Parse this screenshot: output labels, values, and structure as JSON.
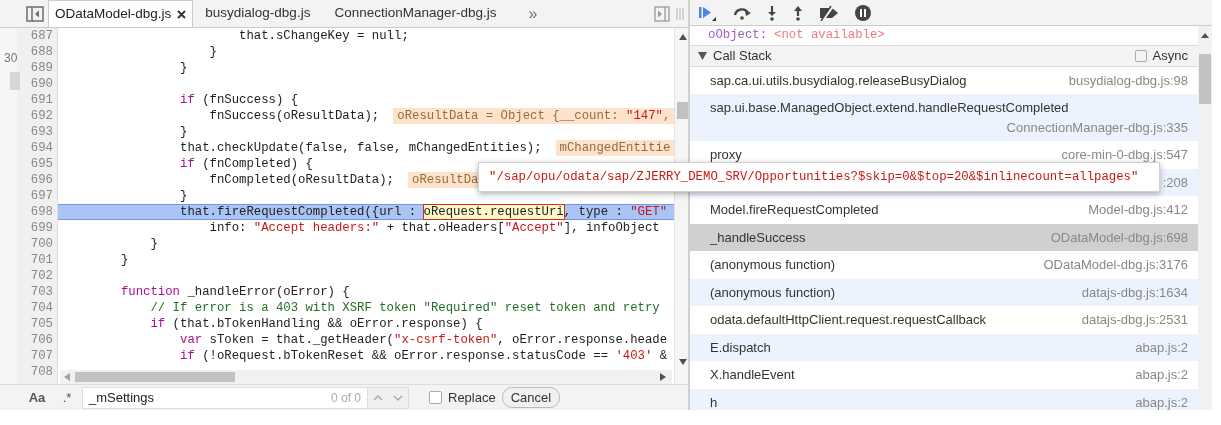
{
  "edge_gutter": {
    "text": "30"
  },
  "tabs": [
    {
      "label": "ODataModel-dbg.js",
      "selected": true,
      "closable": true
    },
    {
      "label": "busydialog-dbg.js",
      "selected": false,
      "closable": false
    },
    {
      "label": "ConnectionManager-dbg.js",
      "selected": false,
      "closable": false
    }
  ],
  "tabs_overflow": "»",
  "code": {
    "lines": [
      {
        "number": "687",
        "current": false,
        "tokens": [
          {
            "kind": "plain",
            "text": "                        that.sChangeKey = null;"
          }
        ]
      },
      {
        "number": "688",
        "current": false,
        "tokens": [
          {
            "kind": "plain",
            "text": "                    }"
          }
        ]
      },
      {
        "number": "689",
        "current": false,
        "tokens": [
          {
            "kind": "plain",
            "text": "                }"
          }
        ]
      },
      {
        "number": "690",
        "current": false
      },
      {
        "number": "691",
        "current": false,
        "tokens": [
          {
            "kind": "keyword",
            "text": "                if"
          },
          {
            "kind": "plain",
            "text": " (fnSuccess) {"
          }
        ]
      },
      {
        "number": "692",
        "current": false,
        "tokens": [
          {
            "kind": "plain",
            "text": "                    fnSuccess(oResultData);"
          }
        ],
        "hint": [
          {
            "kind": "plain",
            "text": "oResultData = Object {__count: "
          },
          {
            "kind": "string",
            "text": "\"147\""
          },
          {
            "kind": "plain",
            "text": ","
          }
        ]
      },
      {
        "number": "693",
        "current": false,
        "tokens": [
          {
            "kind": "plain",
            "text": "                }"
          }
        ]
      },
      {
        "number": "694",
        "current": false,
        "tokens": [
          {
            "kind": "plain",
            "text": "                that.checkUpdate(false, false, mChangedEntities);"
          }
        ],
        "hint": [
          {
            "kind": "plain",
            "text": "mChangedEntitie"
          }
        ]
      },
      {
        "number": "695",
        "current": false,
        "tokens": [
          {
            "kind": "keyword",
            "text": "                if"
          },
          {
            "kind": "plain",
            "text": " (fnCompleted) {"
          }
        ]
      },
      {
        "number": "696",
        "current": false,
        "tokens": [
          {
            "kind": "plain",
            "text": "                    fnCompleted(oResultData);"
          }
        ],
        "hint": [
          {
            "kind": "plain",
            "text": "oResultDa"
          }
        ]
      },
      {
        "number": "697",
        "current": false,
        "tokens": [
          {
            "kind": "plain",
            "text": "                }"
          }
        ]
      },
      {
        "number": "698",
        "current": true,
        "tokens": [
          {
            "kind": "plain",
            "text": "                that.fireRequestCompleted({url : "
          },
          {
            "kind": "hovered",
            "text": "oRequest.requestUri"
          },
          {
            "kind": "plain",
            "text": ", type : "
          },
          {
            "kind": "string",
            "text": "\"GET\""
          }
        ]
      },
      {
        "number": "699",
        "current": false,
        "tokens": [
          {
            "kind": "plain",
            "text": "                    info: "
          },
          {
            "kind": "string",
            "text": "\"Accept headers:\""
          },
          {
            "kind": "plain",
            "text": " + that.oHeaders["
          },
          {
            "kind": "string",
            "text": "\"Accept\""
          },
          {
            "kind": "plain",
            "text": "], infoObject"
          }
        ]
      },
      {
        "number": "700",
        "current": false,
        "tokens": [
          {
            "kind": "plain",
            "text": "            }"
          }
        ]
      },
      {
        "number": "701",
        "current": false,
        "tokens": [
          {
            "kind": "plain",
            "text": "        }"
          }
        ]
      },
      {
        "number": "702",
        "current": false
      },
      {
        "number": "703",
        "current": false,
        "tokens": [
          {
            "kind": "keyword",
            "text": "        function"
          },
          {
            "kind": "plain",
            "text": " _handleError(oError) {"
          }
        ]
      },
      {
        "number": "704",
        "current": false,
        "tokens": [
          {
            "kind": "comment",
            "text": "            // If error is a 403 with XSRF token \"Required\" reset token and retry"
          }
        ]
      },
      {
        "number": "705",
        "current": false,
        "tokens": [
          {
            "kind": "keyword",
            "text": "            if"
          },
          {
            "kind": "plain",
            "text": " (that.bTokenHandling && oError.response) {"
          }
        ]
      },
      {
        "number": "706",
        "current": false,
        "tokens": [
          {
            "kind": "keyword",
            "text": "                var"
          },
          {
            "kind": "plain",
            "text": " sToken = that._getHeader("
          },
          {
            "kind": "string",
            "text": "\"x-csrf-token\""
          },
          {
            "kind": "plain",
            "text": ", oError.response.heade"
          }
        ]
      },
      {
        "number": "707",
        "current": false,
        "tokens": [
          {
            "kind": "keyword",
            "text": "                if"
          },
          {
            "kind": "plain",
            "text": " (!oRequest.bTokenReset && oError.response.statusCode == "
          },
          {
            "kind": "string",
            "text": "'403'"
          },
          {
            "kind": "plain",
            "text": " &"
          }
        ]
      },
      {
        "number": "708",
        "current": false
      }
    ]
  },
  "tooltip": {
    "text": "\"/sap/opu/odata/sap/ZJERRY_DEMO_SRV/Opportunities?$skip=0&$top=20&$inlinecount=allpages\""
  },
  "search_bar": {
    "match_case": "Aa",
    "regex": ".*",
    "query": "_mSettings",
    "count": "0 of 0",
    "replace": {
      "label": "Replace",
      "checked": false
    },
    "cancel": "Cancel"
  },
  "scope_variable": {
    "name": "oObject:",
    "value": "<not available>"
  },
  "call_stack": {
    "title": "Call Stack",
    "expanded": true,
    "async": {
      "label": "Async",
      "checked": false
    },
    "frames": [
      {
        "function": "sap.ca.ui.utils.busydialog.releaseBusyDialog",
        "location": "busydialog-dbg.js:98",
        "selected": false
      },
      {
        "function": "sap.ui.base.ManagedObject.extend.handleRequestCompleted",
        "location": "ConnectionManager-dbg.js:335",
        "selected": false
      },
      {
        "function": "proxy",
        "location": "core-min-0-dbg.js:547",
        "selected": false
      },
      {
        "location": ":208",
        "selected": false
      },
      {
        "function": "Model.fireRequestCompleted",
        "location": "Model-dbg.js:412",
        "selected": false
      },
      {
        "function": "_handleSuccess",
        "location": "ODataModel-dbg.js:698",
        "selected": true
      },
      {
        "function": "(anonymous function)",
        "location": "ODataModel-dbg.js:3176",
        "selected": false
      },
      {
        "function": "(anonymous function)",
        "location": "datajs-dbg.js:1634",
        "selected": false
      },
      {
        "function": "odata.defaultHttpClient.request.requestCallback",
        "location": "datajs-dbg.js:2531",
        "selected": false
      },
      {
        "function": "E.dispatch",
        "location": "abap.js:2",
        "selected": false
      },
      {
        "function": "X.handleEvent",
        "location": "abap.js:2",
        "selected": false
      },
      {
        "function": "h",
        "location": "abap.js:2",
        "selected": false
      }
    ]
  }
}
